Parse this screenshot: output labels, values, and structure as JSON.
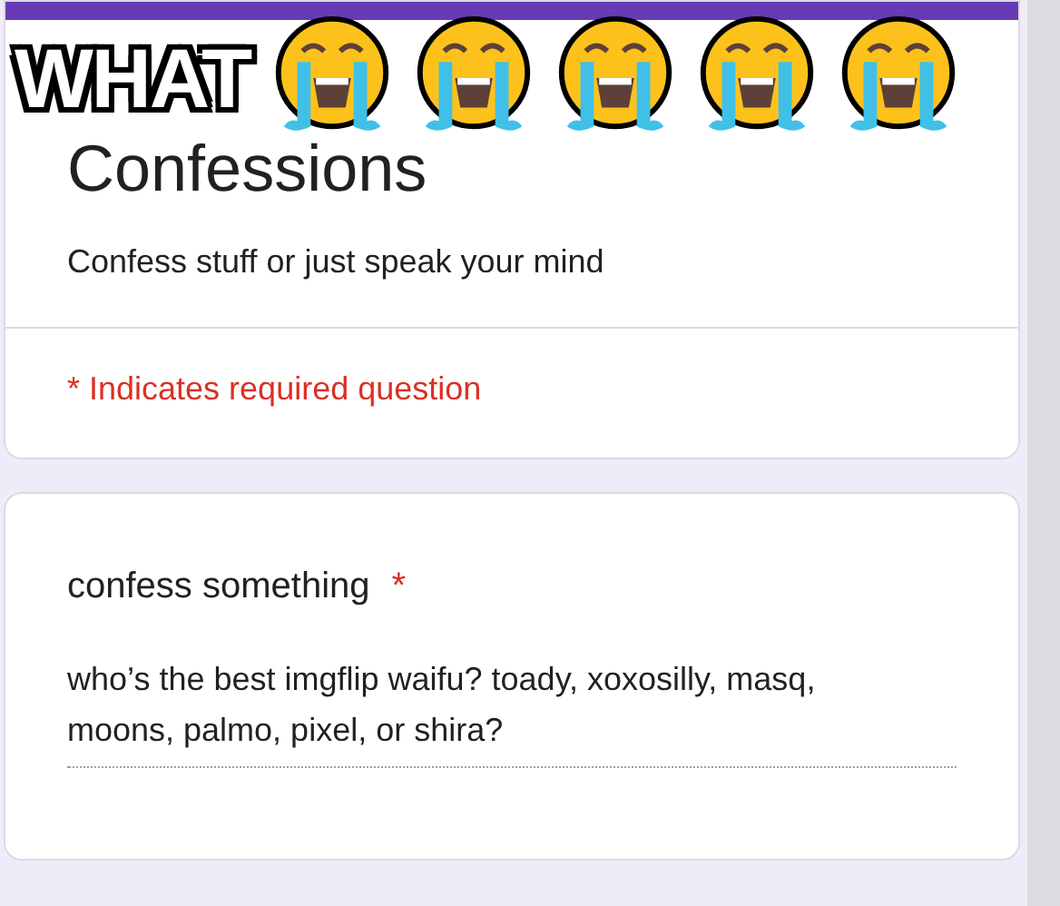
{
  "caption": {
    "text": "WHAT"
  },
  "form": {
    "title": "Confessions",
    "description": "Confess stuff or just speak your mind",
    "required_note": "* Indicates required question"
  },
  "questions": [
    {
      "label": "confess something",
      "required": true,
      "required_mark": "*",
      "answer": "who’s the best imgflip waifu? toady, xoxosilly, masq, moons, palmo, pixel, or shira?"
    }
  ]
}
